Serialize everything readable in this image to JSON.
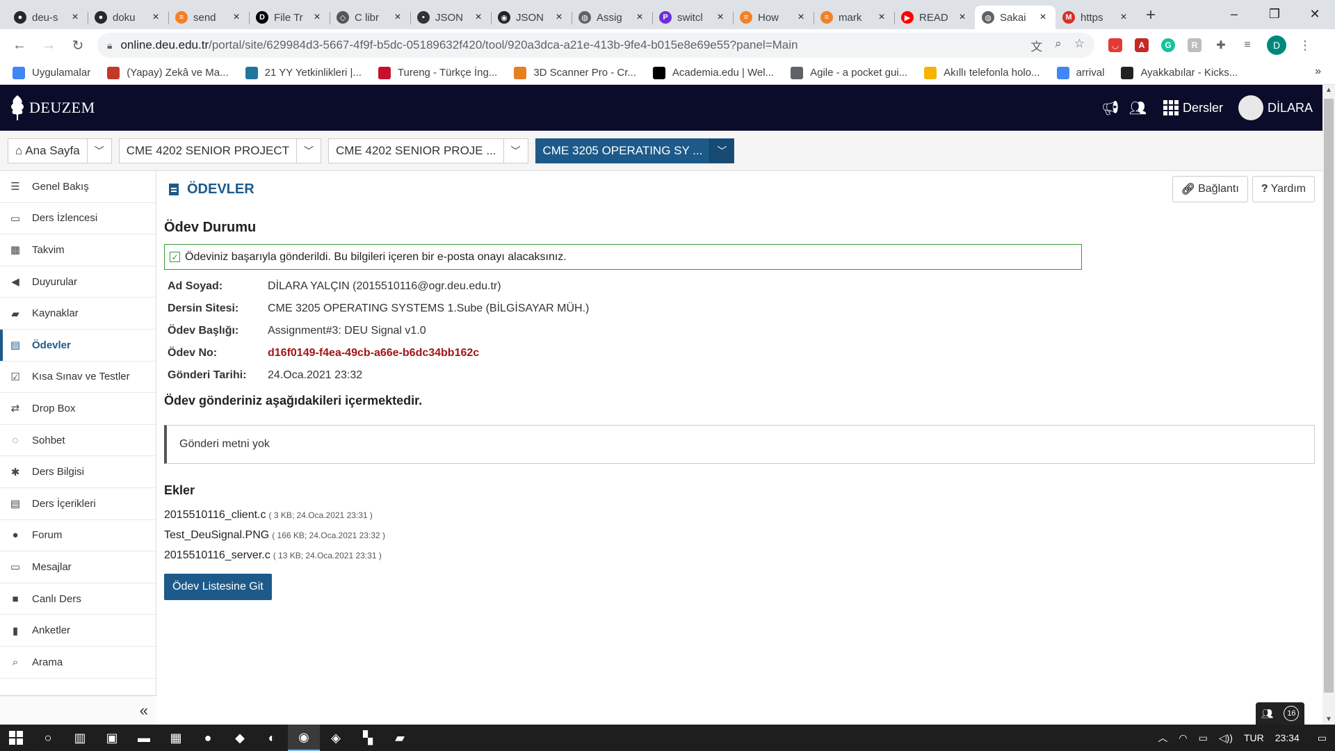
{
  "browser": {
    "tabs": [
      {
        "title": "deu-s",
        "color": "#24292e",
        "glyph": "●"
      },
      {
        "title": "doku",
        "color": "#24292e",
        "glyph": "●"
      },
      {
        "title": "send",
        "color": "#f48024",
        "glyph": "≡"
      },
      {
        "title": "File Tr",
        "color": "#000000",
        "glyph": "D"
      },
      {
        "title": "C libr",
        "color": "#555555",
        "glyph": "◇"
      },
      {
        "title": "JSON",
        "color": "#333333",
        "glyph": "▪"
      },
      {
        "title": "JSON",
        "color": "#222222",
        "glyph": "◉"
      },
      {
        "title": "Assig",
        "color": "#5f6368",
        "glyph": "◍"
      },
      {
        "title": "switcl",
        "color": "#6b2fd6",
        "glyph": "P"
      },
      {
        "title": "How",
        "color": "#f48024",
        "glyph": "≡"
      },
      {
        "title": "mark",
        "color": "#f48024",
        "glyph": "≡"
      },
      {
        "title": "READ",
        "color": "#ff0000",
        "glyph": "▶"
      },
      {
        "title": "Sakai",
        "color": "#5f6368",
        "glyph": "◍"
      },
      {
        "title": "https",
        "color": "#d93025",
        "glyph": "M"
      }
    ],
    "active_tab": 12,
    "new_tab": "+",
    "window_controls": [
      "–",
      "❐",
      "✕"
    ],
    "url_host": "online.deu.edu.tr",
    "url_path": "/portal/site/629984d3-5667-4f9f-b5dc-05189632f420/tool/920a3dca-a21e-413b-9fe4-b015e8e69e55?panel=Main",
    "profile_initial": "D",
    "bookmarks": [
      {
        "label": "Uygulamalar",
        "color": "#4285f4"
      },
      {
        "label": "(Yapay) Zekâ ve Ma...",
        "color": "#c0392b"
      },
      {
        "label": "21 YY Yetkinlikleri |...",
        "color": "#21759b"
      },
      {
        "label": "Tureng - Türkçe İng...",
        "color": "#c8102e"
      },
      {
        "label": "3D Scanner Pro - Cr...",
        "color": "#e67e22"
      },
      {
        "label": "Academia.edu | Wel...",
        "color": "#000000"
      },
      {
        "label": "Agile - a pocket gui...",
        "color": "#5f6368"
      },
      {
        "label": "Akıllı telefonla holo...",
        "color": "#f4b400"
      },
      {
        "label": "arrival",
        "color": "#4285f4"
      },
      {
        "label": "Ayakkabılar - Kicks...",
        "color": "#222222"
      }
    ]
  },
  "site": {
    "logo_text": "DEUZEM",
    "courses_label": "Dersler",
    "user_name": "DİLARA",
    "site_tabs": [
      {
        "label": "Ana Sayfa",
        "icon": "⌂"
      },
      {
        "label": "CME 4202 SENIOR PROJECT"
      },
      {
        "label": "CME 4202 SENIOR PROJE ..."
      },
      {
        "label": "CME 3205 OPERATING SY ..."
      }
    ]
  },
  "nav": {
    "items": [
      {
        "label": "Genel Bakış",
        "icon": "☰"
      },
      {
        "label": "Ders İzlencesi",
        "icon": "▭"
      },
      {
        "label": "Takvim",
        "icon": "▦"
      },
      {
        "label": "Duyurular",
        "icon": "◀"
      },
      {
        "label": "Kaynaklar",
        "icon": "▰"
      },
      {
        "label": "Ödevler",
        "icon": "▤"
      },
      {
        "label": "Kısa Sınav ve Testler",
        "icon": "☑"
      },
      {
        "label": "Drop Box",
        "icon": "⇄"
      },
      {
        "label": "Sohbet",
        "icon": "◌"
      },
      {
        "label": "Ders Bilgisi",
        "icon": "✱"
      },
      {
        "label": "Ders İçerikleri",
        "icon": "▤"
      },
      {
        "label": "Forum",
        "icon": "●"
      },
      {
        "label": "Mesajlar",
        "icon": "▭"
      },
      {
        "label": "Canlı Ders",
        "icon": "■"
      },
      {
        "label": "Anketler",
        "icon": "▮"
      },
      {
        "label": "Arama",
        "icon": "⌕"
      }
    ],
    "active_index": 5,
    "collapse_glyph": "«"
  },
  "main": {
    "tool_title": "ÖDEVLER",
    "link_button": "Bağlantı",
    "help_button": "Yardım",
    "status_heading": "Ödev Durumu",
    "success_message": "Ödeviniz başarıyla gönderildi. Bu bilgileri içeren bir e-posta onayı alacaksınız.",
    "details": {
      "name_label": "Ad Soyad:",
      "name_value": "DİLARA YALÇIN (2015510116@ogr.deu.edu.tr)",
      "site_label": "Dersin Sitesi:",
      "site_value": "CME 3205 OPERATING SYSTEMS 1.Sube (BİLGİSAYAR MÜH.)",
      "title_label": "Ödev Başlığı:",
      "title_value": "Assignment#3: DEU Signal v1.0",
      "ref_label": "Ödev No:",
      "ref_value": "d16f0149-f4ea-49cb-a66e-b6dc34bb162c",
      "date_label": "Gönderi Tarihi:",
      "date_value": "24.Oca.2021 23:32"
    },
    "contents_heading": "Ödev gönderiniz aşağıdakileri içermektedir.",
    "submission_text": "Gönderi metni yok",
    "attachments_heading": "Ekler",
    "attachments": [
      {
        "name": "2015510116_client.c",
        "meta": "( 3 KB; 24.Oca.2021 23:31 )"
      },
      {
        "name": "Test_DeuSignal.PNG",
        "meta": "( 166 KB; 24.Oca.2021 23:32 )"
      },
      {
        "name": "2015510116_server.c",
        "meta": "( 13 KB; 24.Oca.2021 23:31 )"
      }
    ],
    "back_button": "Ödev Listesine Git"
  },
  "chat": {
    "count": "16"
  },
  "taskbar": {
    "apps": [
      {
        "name": "search-icon",
        "glyph": "○"
      },
      {
        "name": "task-view-icon",
        "glyph": "▥"
      },
      {
        "name": "store-icon",
        "glyph": "▣"
      },
      {
        "name": "file-explorer-icon",
        "glyph": "▬"
      },
      {
        "name": "calendar-app-icon",
        "glyph": "▦"
      },
      {
        "name": "maps-icon",
        "glyph": "●"
      },
      {
        "name": "vscode-icon",
        "glyph": "◆"
      },
      {
        "name": "edge-icon",
        "glyph": "◐"
      },
      {
        "name": "chrome-icon",
        "glyph": "◉"
      },
      {
        "name": "virtualbox-icon",
        "glyph": "◈"
      },
      {
        "name": "app-icon",
        "glyph": "▚"
      },
      {
        "name": "sticky-notes-icon",
        "glyph": "▰"
      }
    ],
    "active_app": 8,
    "language": "TUR",
    "time": "23:34"
  }
}
